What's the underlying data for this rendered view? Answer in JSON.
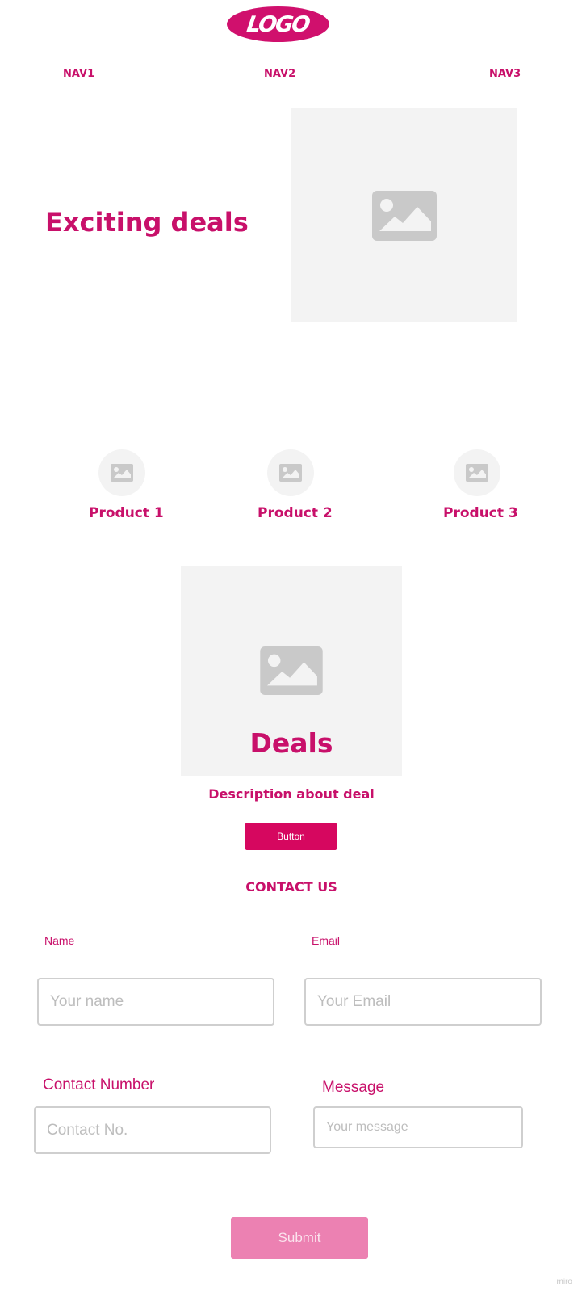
{
  "header": {
    "logo_text": "LOGO",
    "nav": [
      "NAV1",
      "NAV2",
      "NAV3"
    ]
  },
  "hero": {
    "title": "Exciting deals",
    "image_icon": "image-placeholder-icon"
  },
  "products": [
    {
      "label": "Product 1",
      "icon": "image-placeholder-icon"
    },
    {
      "label": "Product 2",
      "icon": "image-placeholder-icon"
    },
    {
      "label": "Product 3",
      "icon": "image-placeholder-icon"
    }
  ],
  "deals": {
    "title": "Deals",
    "description": "Description about deal",
    "button_label": "Button"
  },
  "contact": {
    "heading": "CONTACT US",
    "name_label": "Name",
    "name_placeholder": "Your name",
    "email_label": "Email",
    "email_placeholder": "Your Email",
    "phone_label": "Contact Number",
    "phone_placeholder": "Contact No.",
    "message_label": "Message",
    "message_placeholder": "Your message",
    "submit_label": "Submit"
  },
  "watermark": "miro",
  "colors": {
    "accent": "#c8106a",
    "button": "#d6075f",
    "submit": "#ec81b2",
    "placeholder_bg": "#f3f3f3",
    "placeholder_icon": "#c9c9c9"
  }
}
